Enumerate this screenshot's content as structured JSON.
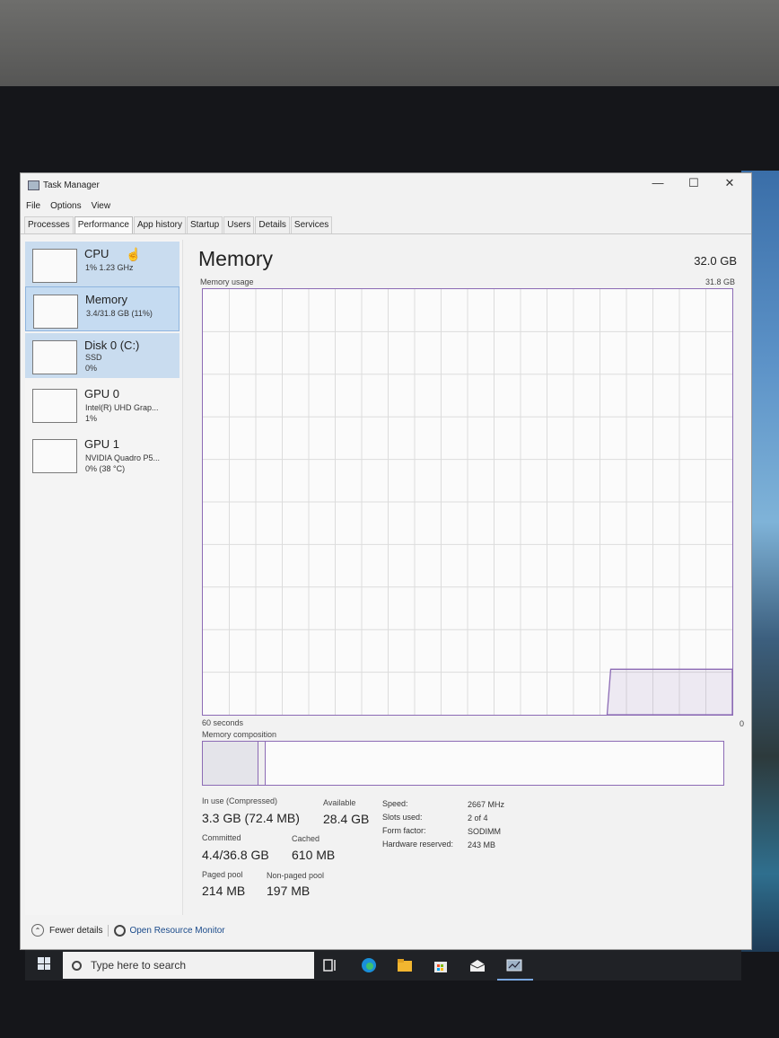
{
  "window": {
    "title": "Task Manager"
  },
  "menu": [
    "File",
    "Options",
    "View"
  ],
  "tabs": [
    "Processes",
    "Performance",
    "App history",
    "Startup",
    "Users",
    "Details",
    "Services"
  ],
  "sidebar": [
    {
      "title": "CPU",
      "line1": "1% 1.23 GHz"
    },
    {
      "title": "Memory",
      "line1": "3.4/31.8 GB (11%)"
    },
    {
      "title": "Disk 0 (C:)",
      "line1": "SSD",
      "line2": "0%"
    },
    {
      "title": "GPU 0",
      "line1": "Intel(R) UHD Grap...",
      "line2": "1%"
    },
    {
      "title": "GPU 1",
      "line1": "NVIDIA Quadro P5...",
      "line2": "0% (38 °C)"
    }
  ],
  "main": {
    "title": "Memory",
    "total": "32.0 GB",
    "usage_label": "Memory usage",
    "usage_max": "31.8 GB",
    "seconds_label": "60 seconds",
    "zero_label": "0",
    "composition_label": "Memory composition"
  },
  "usage_chart": {
    "type": "area",
    "ylim": [
      0,
      31.8
    ],
    "values_gb": [
      3.4,
      3.4,
      3.4,
      3.4
    ]
  },
  "stats": {
    "in_use_label": "In use (Compressed)",
    "in_use_value": "3.3 GB (72.4 MB)",
    "available_label": "Available",
    "available_value": "28.4 GB",
    "committed_label": "Committed",
    "committed_value": "4.4/36.8 GB",
    "cached_label": "Cached",
    "cached_value": "610 MB",
    "paged_label": "Paged pool",
    "paged_value": "214 MB",
    "nonpaged_label": "Non-paged pool",
    "nonpaged_value": "197 MB"
  },
  "specs": [
    {
      "label": "Speed:",
      "value": "2667 MHz"
    },
    {
      "label": "Slots used:",
      "value": "2 of 4"
    },
    {
      "label": "Form factor:",
      "value": "SODIMM"
    },
    {
      "label": "Hardware reserved:",
      "value": "243 MB"
    }
  ],
  "footer": {
    "fewer": "Fewer details",
    "monitor": "Open Resource Monitor"
  },
  "taskbar": {
    "search_placeholder": "Type here to search"
  },
  "colors": {
    "accent_purple": "#8c6bb5",
    "selection_blue": "#c5dbf1"
  }
}
